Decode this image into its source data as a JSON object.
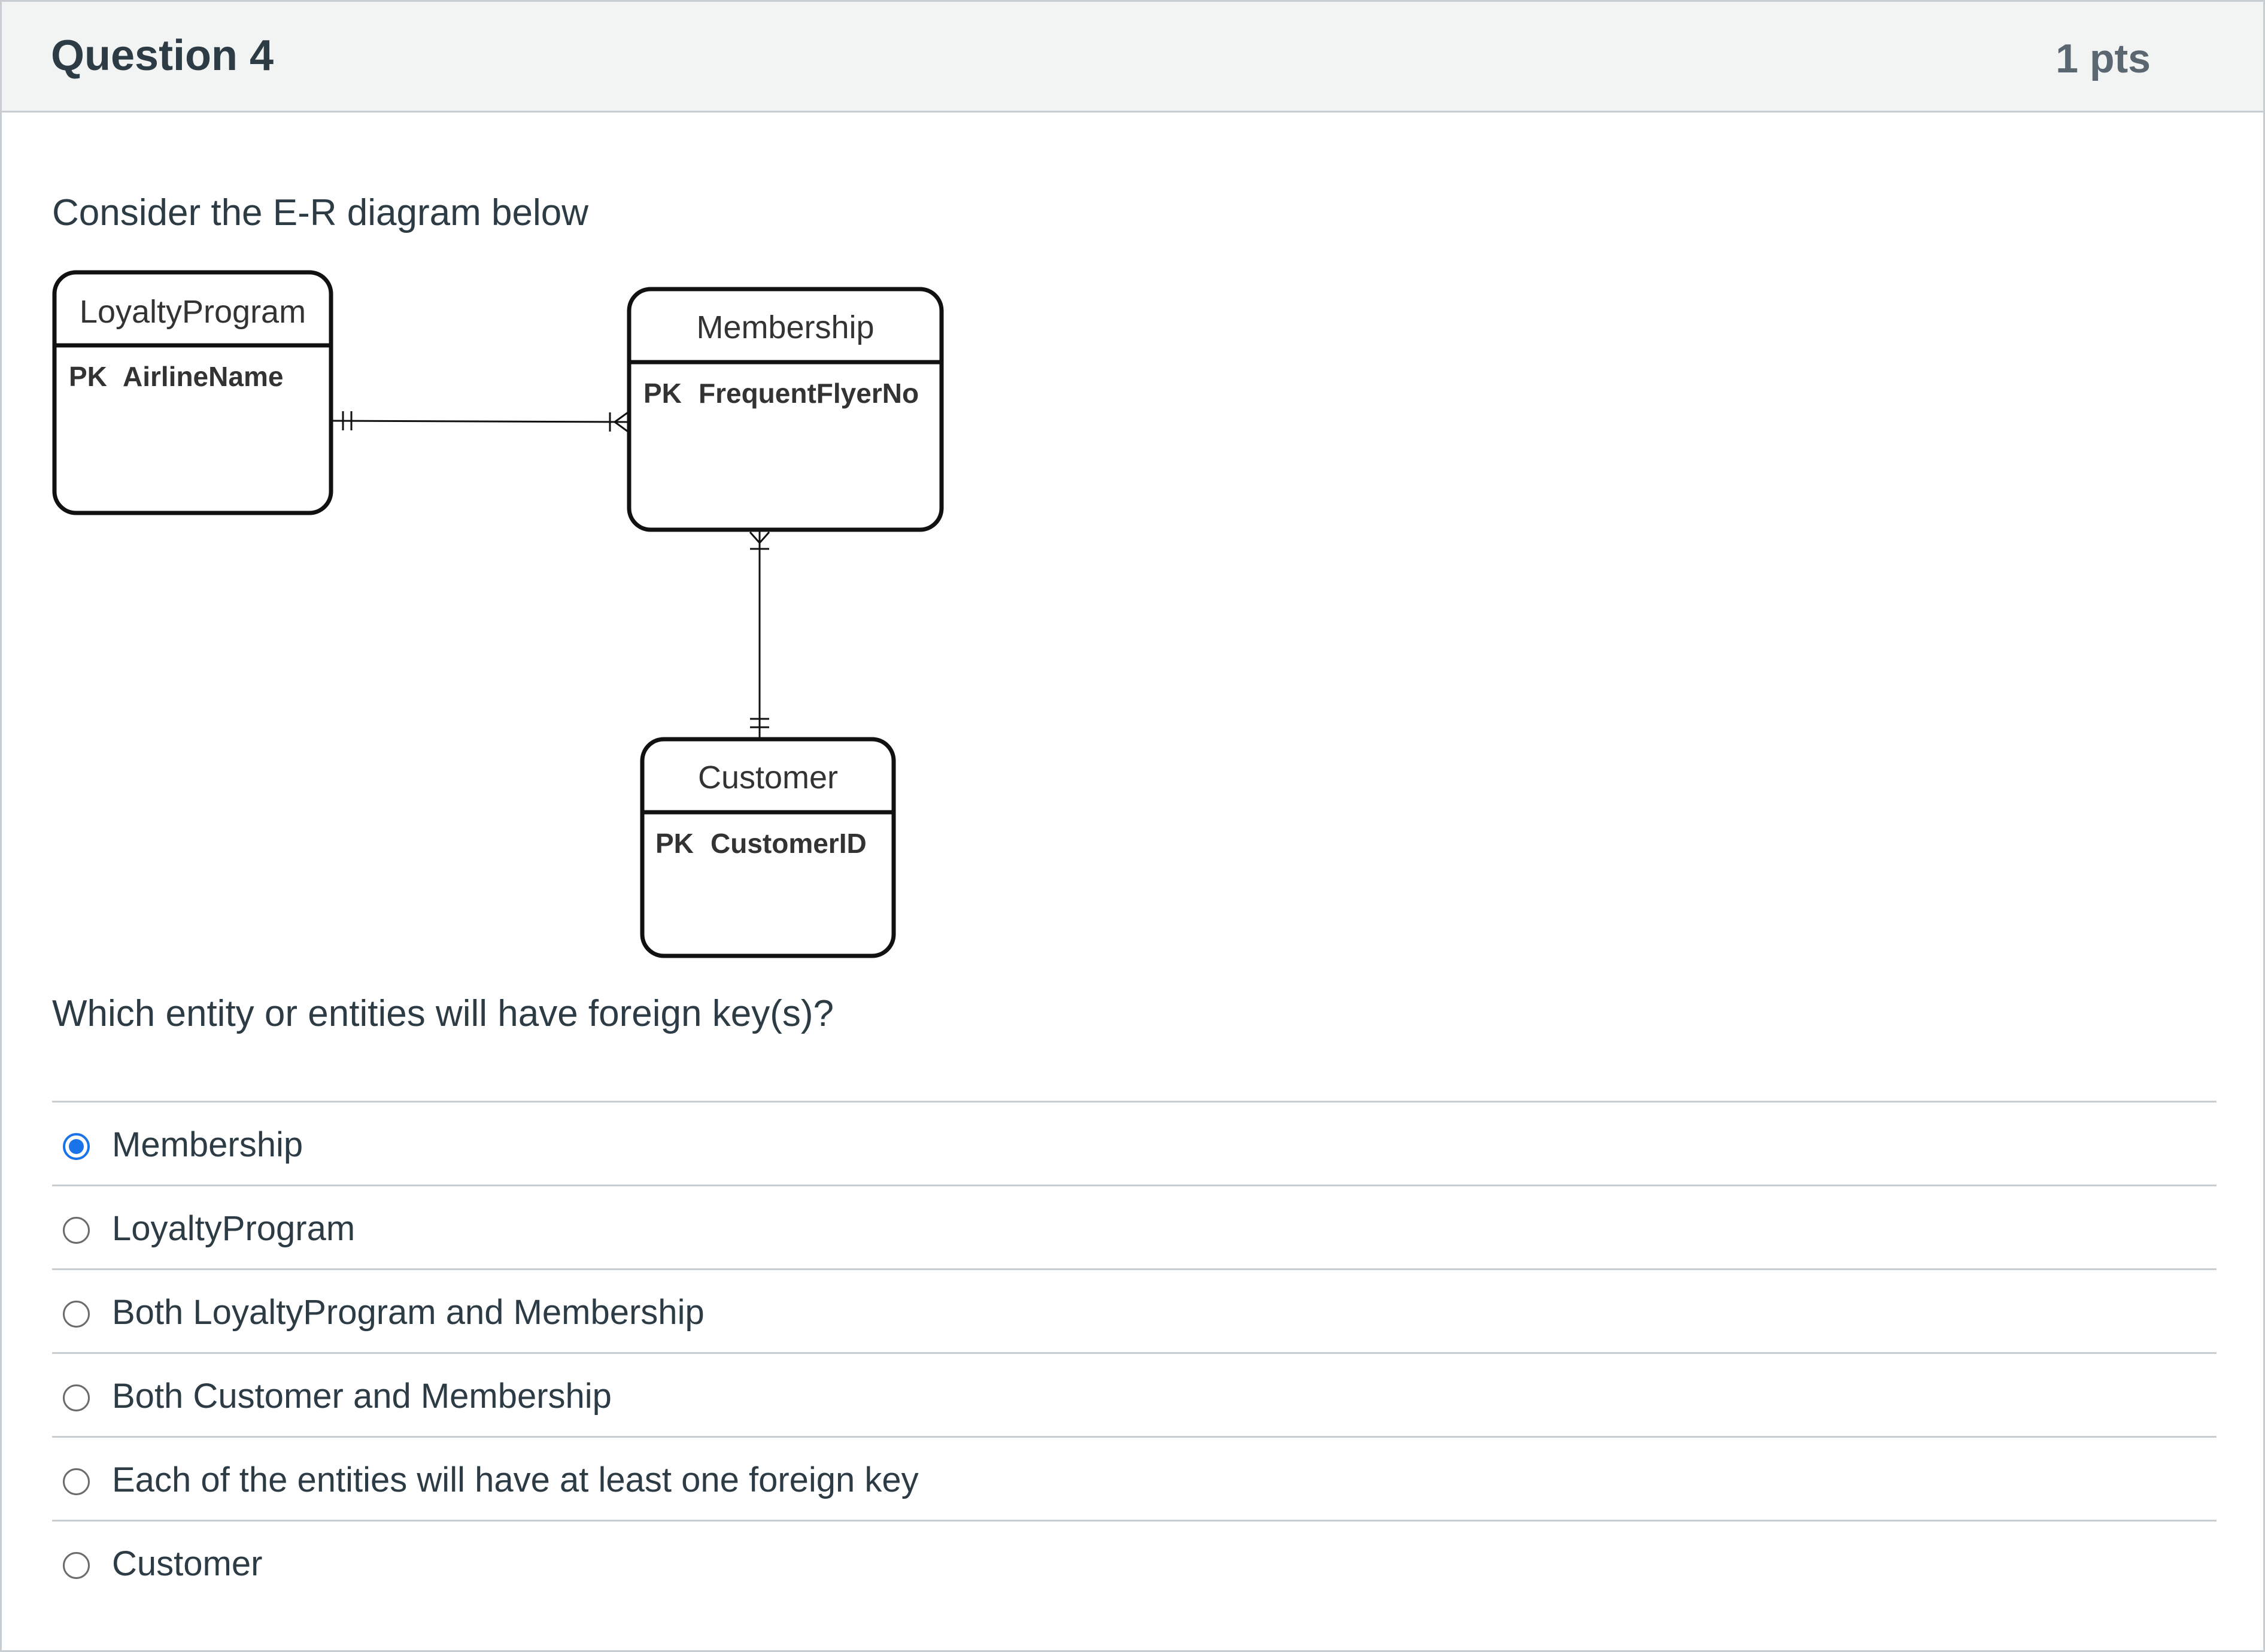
{
  "question": {
    "title": "Question 4",
    "points": "1 pts",
    "prompt": "Consider the E-R diagram below",
    "question_text": "Which entity or entities will have foreign key(s)?"
  },
  "diagram": {
    "entities": [
      {
        "name": "LoyaltyProgram",
        "key_label": "PK",
        "key_field": "AirlineName"
      },
      {
        "name": "Membership",
        "key_label": "PK",
        "key_field": "FrequentFlyerNo"
      },
      {
        "name": "Customer",
        "key_label": "PK",
        "key_field": "CustomerID"
      }
    ],
    "relationships": [
      {
        "from": "LoyaltyProgram",
        "from_cardinality": "one-and-only-one",
        "to": "Membership",
        "to_cardinality": "one-or-many"
      },
      {
        "from": "Customer",
        "from_cardinality": "one-and-only-one",
        "to": "Membership",
        "to_cardinality": "one-or-many"
      }
    ]
  },
  "answers": {
    "selected_index": 0,
    "options": [
      "Membership",
      "LoyaltyProgram",
      "Both LoyaltyProgram and Membership",
      "Both Customer and Membership",
      "Each of the entities will have at least one foreign key",
      "Customer"
    ]
  }
}
